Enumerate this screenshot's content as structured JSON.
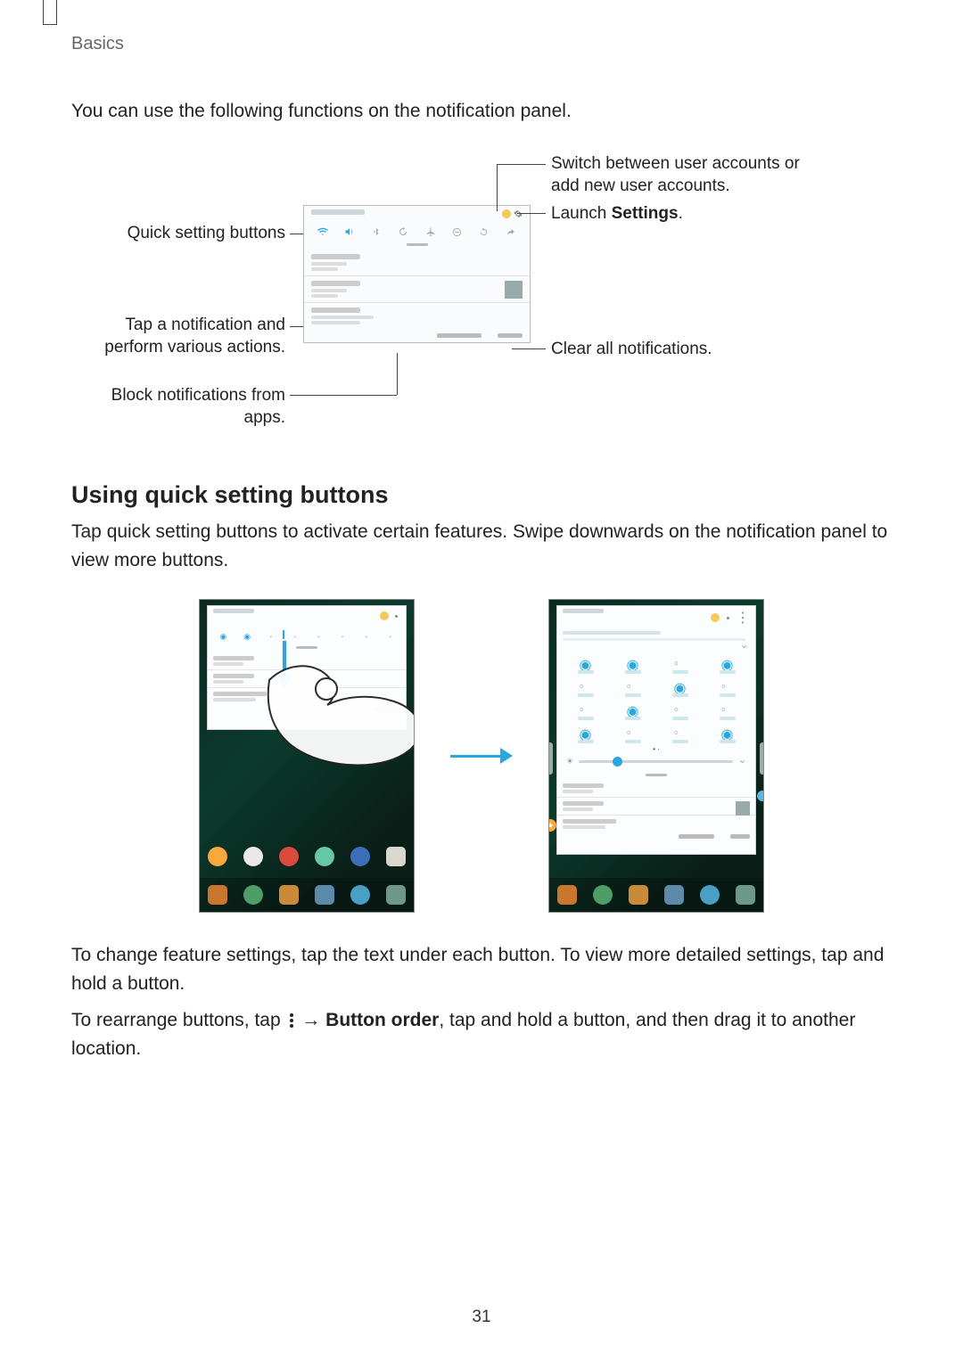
{
  "page": {
    "section": "Basics",
    "number": "31",
    "intro": "You can use the following functions on the notification panel."
  },
  "callouts": {
    "quick_settings": "Quick setting buttons",
    "tap_notification": "Tap a notification and perform various actions.",
    "block_notifications": "Block notifications from apps.",
    "switch_users": "Switch between user accounts or add new user accounts.",
    "launch_settings_pre": "Launch ",
    "launch_settings_bold": "Settings",
    "launch_settings_post": ".",
    "clear_all": "Clear all notifications."
  },
  "quick_settings_section": {
    "heading": "Using quick setting buttons",
    "para1": "Tap quick setting buttons to activate certain features. Swipe downwards on the notification panel to view more buttons.",
    "para2": "To change feature settings, tap the text under each button. To view more detailed settings, tap and hold a button.",
    "para3_pre": "To rearrange buttons, tap ",
    "para3_mid": " → ",
    "para3_bold": "Button order",
    "para3_post": ", tap and hold a button, and then drag it to another location."
  },
  "icons": {
    "set": [
      "wifi",
      "sound",
      "bluetooth",
      "rotate",
      "airplane",
      "dnd",
      "flash",
      "share"
    ]
  }
}
